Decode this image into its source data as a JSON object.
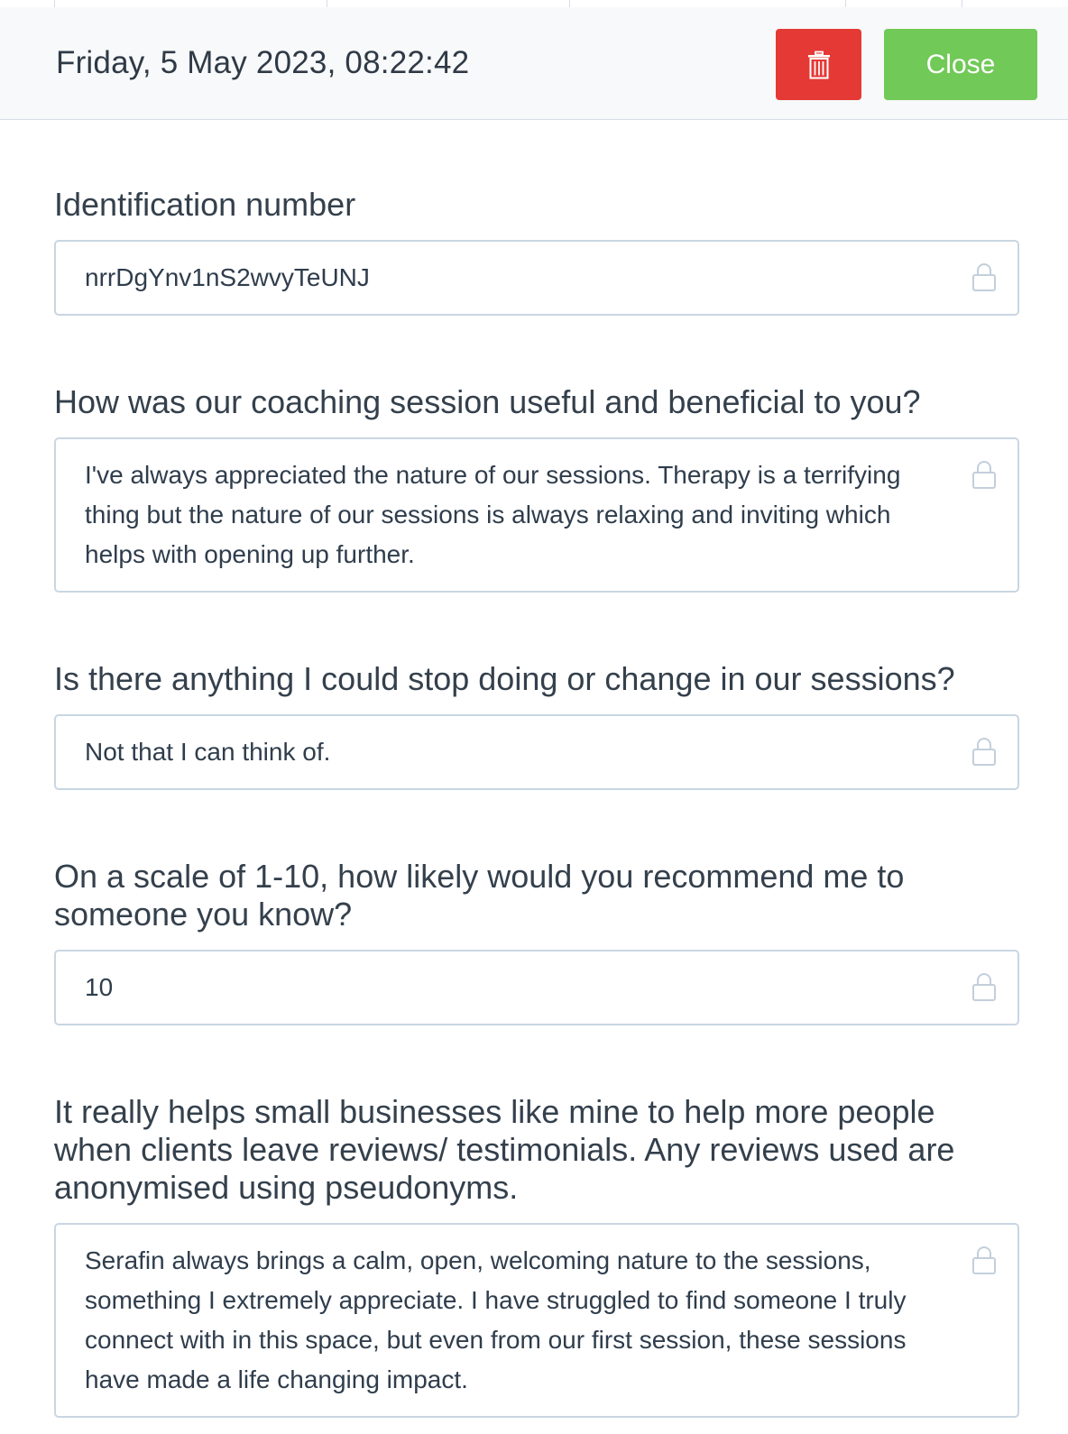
{
  "header": {
    "datetime": "Friday, 5 May 2023, 08:22:42",
    "delete_icon": "trash-icon",
    "close_label": "Close",
    "colors": {
      "delete": "#e53935",
      "close": "#71c957"
    }
  },
  "fields": [
    {
      "label": "Identification number",
      "value": "nrrDgYnv1nS2wvyTeUNJ",
      "icon": "lock-icon"
    },
    {
      "label": "How was our coaching session useful and beneficial to you?",
      "value": "I've always appreciated the nature of our sessions. Therapy is a terrifying thing but the nature of our sessions is always relaxing and inviting which helps with opening up further.",
      "icon": "lock-icon"
    },
    {
      "label": "Is there anything I could stop doing or change in our sessions?",
      "value": "Not that I can think of.",
      "icon": "lock-icon"
    },
    {
      "label": "On a scale of 1-10, how likely would you recommend me to someone you know?",
      "value": "10",
      "icon": "lock-icon"
    },
    {
      "label": "It really helps small businesses like mine to help more people when clients leave reviews/ testimonials. Any reviews used are anonymised using pseudonyms.",
      "value": "Serafin always brings a calm, open, welcoming nature to the sessions, something I extremely appreciate. I have struggled to find someone I truly connect with in this space, but even from our first session, these sessions have made a life changing impact.",
      "icon": "lock-icon"
    }
  ]
}
